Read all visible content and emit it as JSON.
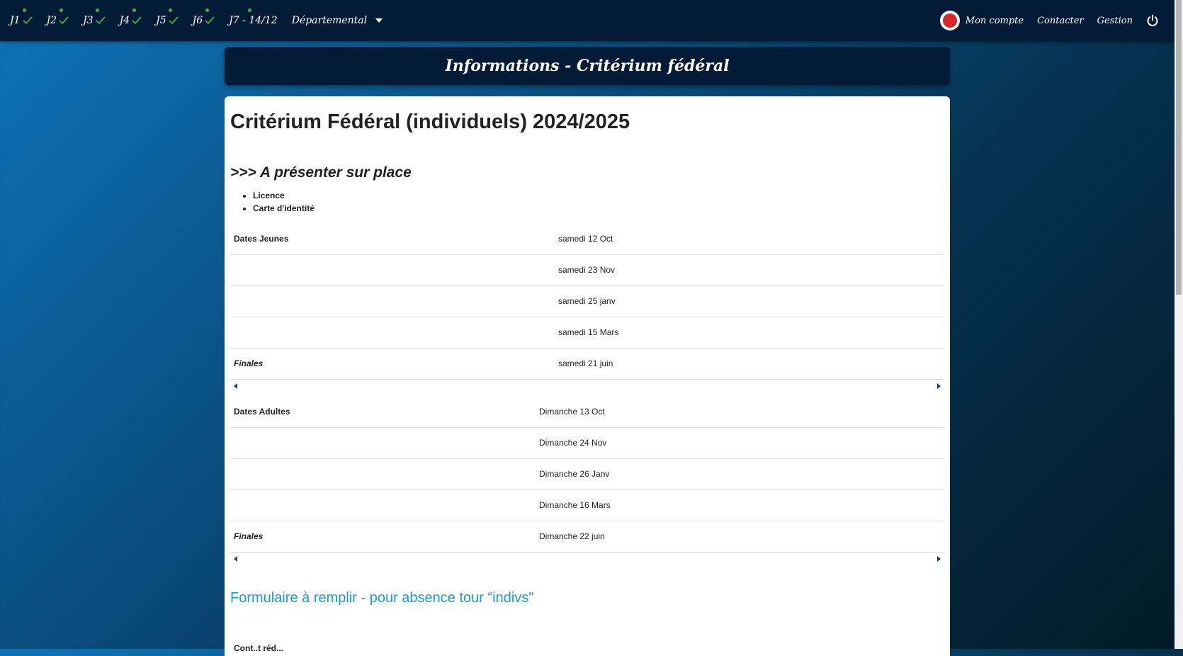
{
  "nav": {
    "journees": [
      {
        "label": "J1",
        "done": true
      },
      {
        "label": "J2",
        "done": true
      },
      {
        "label": "J3",
        "done": true
      },
      {
        "label": "J4",
        "done": true
      },
      {
        "label": "J5",
        "done": true
      },
      {
        "label": "J6",
        "done": true
      }
    ],
    "j7": {
      "label": "J7 - 14/12"
    },
    "dropdown": {
      "label": "Départemental"
    },
    "right": {
      "account_label": "Mon compte",
      "contact_label": "Contacter",
      "gestion_label": "Gestion"
    },
    "icons": {
      "check": "check-icon",
      "power": "power-icon",
      "caret": "caret-down-icon"
    },
    "colors": {
      "nav_bg": "#031b36",
      "check": "#3bb33b",
      "link": "#1b9ad6"
    }
  },
  "header": {
    "title": "Informations - Critérium fédéral"
  },
  "page": {
    "title": "Critérium Fédéral (individuels)  2024/2025",
    "subtitle": ">>> A présenter sur place",
    "documents": [
      "Licence",
      "Carte d'identité"
    ],
    "jeunes": {
      "rows": [
        {
          "label": "Dates Jeunes",
          "value": "samedi 12 Oct"
        },
        {
          "label": "",
          "value": "samedi 23 Nov"
        },
        {
          "label": "",
          "value": "samedi 25  janv"
        },
        {
          "label": "",
          "value": "samedi 15  Mars"
        },
        {
          "label": "Finales",
          "value": "samedi 21 juin"
        }
      ]
    },
    "adultes": {
      "rows": [
        {
          "label": "Dates Adultes",
          "value": "Dimanche 13 Oct"
        },
        {
          "label": "",
          "value": "Dimanche 24 Nov"
        },
        {
          "label": "",
          "value": "Dimanche 26 Janv"
        },
        {
          "label": "",
          "value": "Dimanche 16  Mars"
        },
        {
          "label": "Finales",
          "value": "Dimanche 22 juin"
        }
      ]
    },
    "form_link": "Formulaire à remplir - pour absence tour “indivs\"",
    "cut_text": "Cont..t réd..."
  }
}
